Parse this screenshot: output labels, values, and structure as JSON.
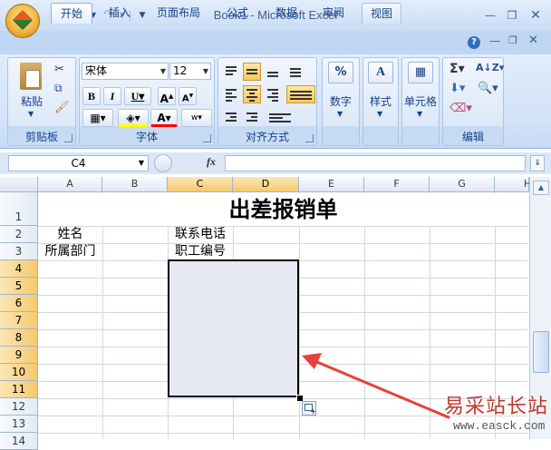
{
  "window": {
    "title": "Book1 - Microsoft Excel"
  },
  "tabs": [
    {
      "label": "开始",
      "active": true
    },
    {
      "label": "插入"
    },
    {
      "label": "页面布局"
    },
    {
      "label": "公式"
    },
    {
      "label": "数据"
    },
    {
      "label": "审阅"
    },
    {
      "label": "视图"
    }
  ],
  "ribbon": {
    "clipboard": {
      "label": "剪贴板",
      "paste_label": "粘贴"
    },
    "font": {
      "label": "字体",
      "font_name": "宋体",
      "font_size": "12"
    },
    "alignment": {
      "label": "对齐方式"
    },
    "number": {
      "label": "数字"
    },
    "styles": {
      "label": "样式"
    },
    "cells": {
      "label": "单元格"
    },
    "editing": {
      "label": "编辑"
    }
  },
  "formula_bar": {
    "name_box": "C4",
    "fx": "fx",
    "value": ""
  },
  "sheet": {
    "columns": [
      "A",
      "B",
      "C",
      "D",
      "E",
      "F",
      "G",
      "H"
    ],
    "rows": [
      "1",
      "2",
      "3",
      "4",
      "5",
      "6",
      "7",
      "8",
      "9",
      "10",
      "11",
      "12",
      "13",
      "14"
    ],
    "selected_columns": [
      "C",
      "D"
    ],
    "selected_rows": [
      "4",
      "5",
      "6",
      "7",
      "8",
      "9",
      "10",
      "11"
    ],
    "selected_range": "C4:D11",
    "cells": {
      "title": "出差报销单",
      "a2": "姓名",
      "a3": "所属部门",
      "c2": "联系电话",
      "c3": "职工编号"
    }
  },
  "watermark": {
    "text": "易采站长站",
    "url": "www.easck.com"
  },
  "colors": {
    "arrow": "#e8403a",
    "selection_fill": "#e6e9f4",
    "header_highlight": "#f5c96f"
  }
}
